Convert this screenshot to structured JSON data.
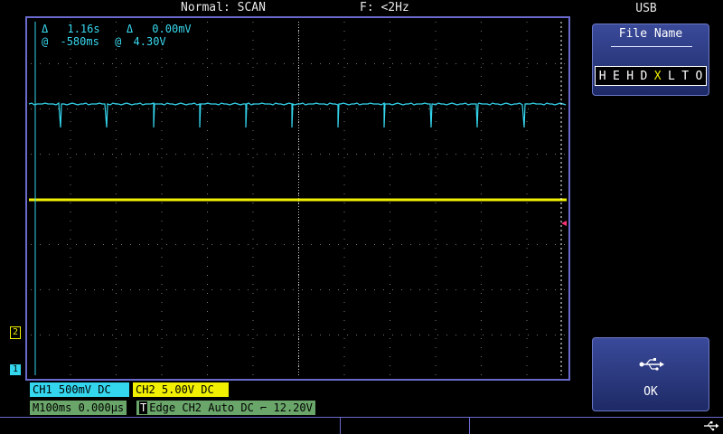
{
  "status_bar": {
    "mode": "Normal: SCAN",
    "frequency": "F: <2Hz"
  },
  "cursor_readout": {
    "row1": {
      "sym_a": "Δ",
      "val_a": "1.16s",
      "sym_b": "Δ",
      "val_b": "0.00mV"
    },
    "row2": {
      "sym_a": "@",
      "val_a": "-580ms",
      "sym_b": "@",
      "val_b": "4.30V"
    }
  },
  "side_menu": {
    "title": "USB",
    "file_name_label": "File Name",
    "file_name_chars": [
      "H",
      "E",
      "H",
      "D",
      "X",
      "L",
      "T",
      "O"
    ],
    "selected_char_index": 4,
    "ok_label": "OK",
    "ok_icon": "usb-icon"
  },
  "channel_bar": {
    "ch1": "CH1  500mV  DC",
    "ch2": "CH2  5.00V  DC"
  },
  "timebase_bar": {
    "timebase": "M100ms 0.000μs",
    "trigger_icon": "T",
    "trigger": "Edge CH2 Auto DC ⌐ 12.20V"
  },
  "markers": {
    "ch1": "1",
    "ch2": "2"
  },
  "colors": {
    "ch1": "#34d6ee",
    "ch2": "#f0f000",
    "frame": "#6a6acd",
    "trigger_marker": "#ff3377"
  }
}
